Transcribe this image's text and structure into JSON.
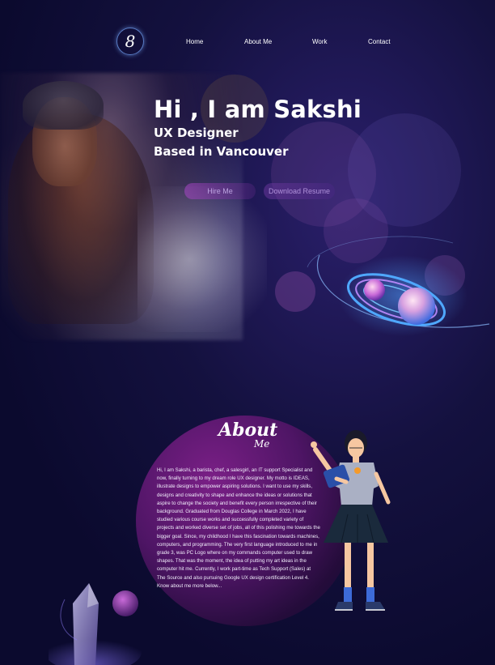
{
  "nav": {
    "logo_glyph": "8",
    "items": [
      {
        "label": "Home"
      },
      {
        "label": "About Me"
      },
      {
        "label": "Work"
      },
      {
        "label": "Contact"
      }
    ]
  },
  "hero": {
    "title": "Hi ,  I am Sakshi",
    "role": "UX Designer",
    "location": "Based in Vancouver",
    "hire_button": "Hire Me",
    "resume_button": "Download Resume"
  },
  "about": {
    "heading": "About",
    "heading_sub": "Me",
    "body": "Hi, I am Sakshi, a barista, chef, a salesgirl, an IT support Specialist and now, finally turning to my dream role UX designer. My motto is IDEAS, illustrate designs to empower aspiring solutions. I want to use my skills, designs and creativity to shape and enhance the ideas or solutions that aspire to change the society and benefit every person irrespective of their background. Graduated from Douglas College in March 2022, I have studied various course works and successfully completed variety of projects and worked diverse set of jobs, all of this polishing me towards the bigger goal. Since, my childhood I have this fascination towards machines, computers, and programming. The very first language introduced to me in grade 3, was PC Logo where on my commands computer used to draw shapes. That was the moment, the idea of putting my art ideas in the computer hit me. Currently, I work part-time as Tech Support (Sales) at The Source and also pursuing Google UX design certification Level 4. Know about me more below..."
  },
  "colors": {
    "background": "#0b0a2e",
    "accent_purple": "#7a1f86",
    "button_pink": "#aa46c8",
    "planet_blue": "#4fa8ff"
  },
  "icons": [
    "logo-monogram-icon",
    "planet-orbit-illustration",
    "crystal-illustration",
    "girl-with-tablet-illustration"
  ]
}
